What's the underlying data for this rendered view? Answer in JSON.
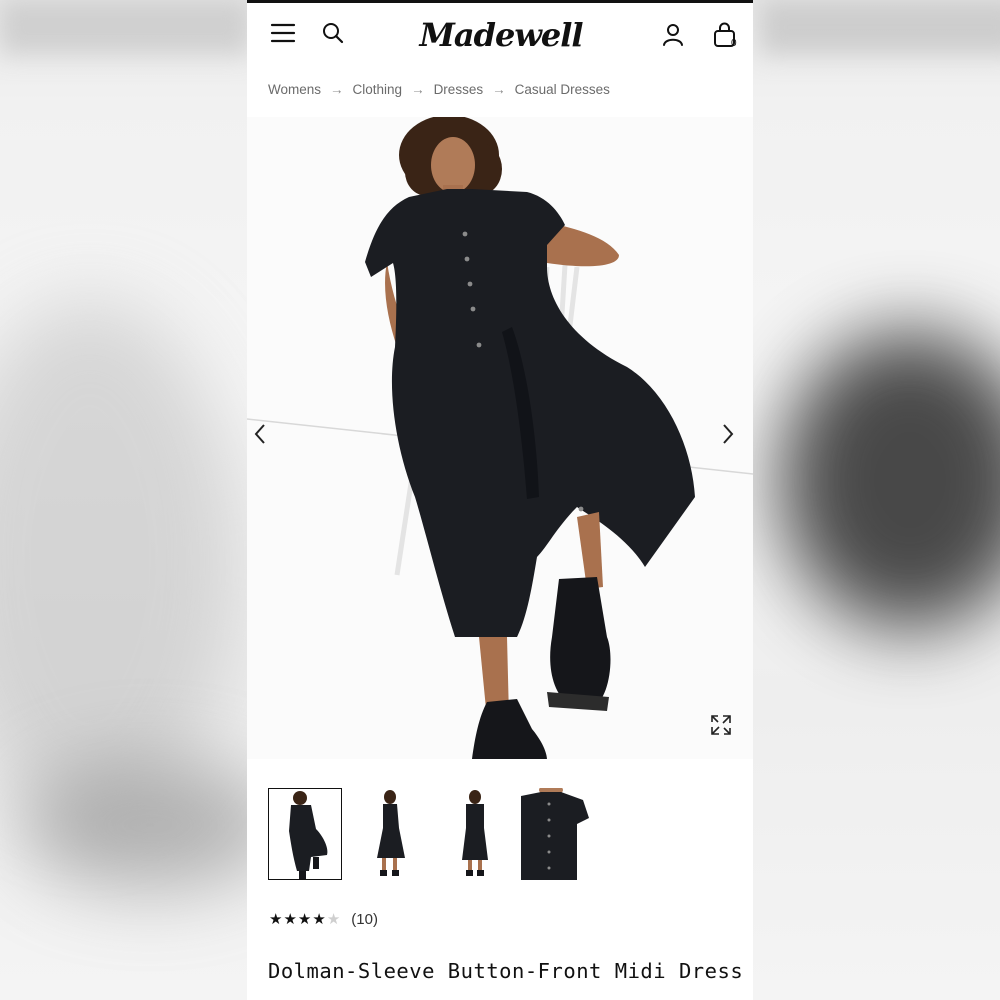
{
  "brand": {
    "logo_text": "Madewell"
  },
  "header": {
    "bag_count": "0",
    "icons": [
      "hamburger-menu-icon",
      "search-icon",
      "account-icon",
      "shopping-bag-icon"
    ]
  },
  "breadcrumb": [
    "Womens",
    "Clothing",
    "Dresses",
    "Casual Dresses"
  ],
  "breadcrumb_separator": "→",
  "gallery": {
    "thumbnail_count": 4,
    "selected_index": 0
  },
  "product": {
    "rating": 4,
    "rating_max": 5,
    "review_count": "(10)",
    "title": "Dolman-Sleeve Button-Front Midi Dress"
  },
  "colors": {
    "text": "#111111",
    "muted": "#6b6b6b",
    "dress": "#1b1d22"
  }
}
